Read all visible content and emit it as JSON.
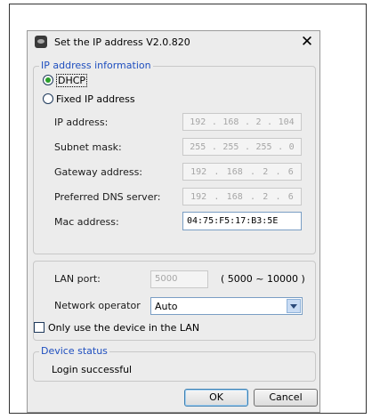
{
  "dialog": {
    "title": "Set the IP address   V2.0.820"
  },
  "ip_group": {
    "legend": "IP address information",
    "dhcp_label": "DHCP",
    "fixed_label": "Fixed IP address",
    "selected_mode": "DHCP",
    "fields": [
      {
        "label": "IP address:",
        "octets": [
          "192",
          "168",
          "2",
          "104"
        ]
      },
      {
        "label": "Subnet mask:",
        "octets": [
          "255",
          "255",
          "255",
          "0"
        ]
      },
      {
        "label": "Gateway address:",
        "octets": [
          "192",
          "168",
          "2",
          "6"
        ]
      },
      {
        "label": "Preferred DNS server:",
        "octets": [
          "192",
          "168",
          "2",
          "6"
        ]
      }
    ],
    "mac_label": "Mac address:",
    "mac_value": "04:75:F5:17:B3:5E"
  },
  "lan_group": {
    "port_label": "LAN port:",
    "port_value": "5000",
    "port_range": "( 5000 ~ 10000 )",
    "operator_label": "Network operator",
    "operator_value": "Auto",
    "lan_only_label": "Only use the device in the LAN",
    "lan_only_checked": false
  },
  "status_group": {
    "legend": "Device status",
    "text": "Login successful"
  },
  "buttons": {
    "ok": "OK",
    "cancel": "Cancel"
  }
}
